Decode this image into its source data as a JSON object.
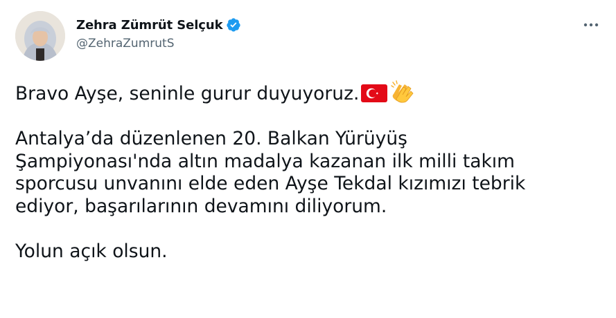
{
  "author": {
    "display_name": "Zehra Zümrüt Selçuk",
    "handle": "@ZehraZumrutS",
    "verified": true
  },
  "icons": {
    "verified": "verified-badge-icon",
    "more": "more-options-icon",
    "flag": "turkey-flag-icon",
    "clap": "clapping-hands-icon"
  },
  "tweet": {
    "line1": "Bravo Ayşe, seninle gurur duyuyoruz.",
    "line2": "Antalya’da düzenlenen 20. Balkan Yürüyüş",
    "line3": "Şampiyonası'nda altın madalya kazanan ilk milli takım",
    "line4": "sporcusu unvanını elde eden Ayşe Tekdal kızımızı tebrik",
    "line5": "ediyor, başarılarının devamını diliyorum.",
    "line6": "Yolun açık olsun."
  },
  "colors": {
    "text": "#0f1419",
    "secondary": "#536471",
    "verified_blue": "#1d9bf0",
    "flag_red": "#e30a17"
  }
}
